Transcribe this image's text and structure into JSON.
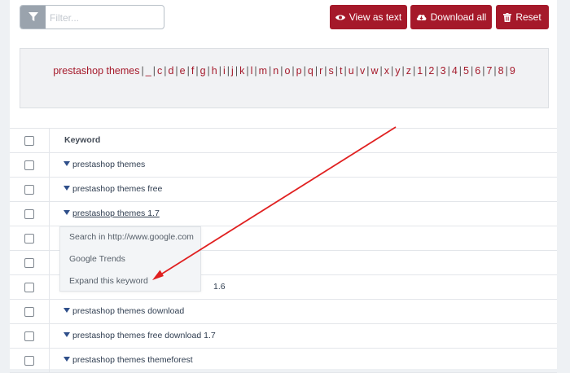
{
  "filter": {
    "placeholder": "Filter...",
    "icon": "filter-icon"
  },
  "buttons": {
    "view_as_text": "View as text",
    "download_all": "Download all",
    "reset": "Reset"
  },
  "colors": {
    "accent": "#a5192a",
    "link": "#2f4f8a",
    "text": "#2f3d50"
  },
  "alphabet": {
    "items": [
      "prestashop themes",
      "_",
      "c",
      "d",
      "e",
      "f",
      "g",
      "h",
      "i",
      "j",
      "k",
      "l",
      "m",
      "n",
      "o",
      "p",
      "q",
      "r",
      "s",
      "t",
      "u",
      "v",
      "w",
      "x",
      "y",
      "z",
      "1",
      "2",
      "3",
      "4",
      "5",
      "6",
      "7",
      "8",
      "9"
    ],
    "separator": "|"
  },
  "table": {
    "header": "Keyword",
    "rows": [
      "prestashop themes",
      "prestashop themes free",
      "prestashop themes 1.7",
      "",
      "",
      "1.6",
      "prestashop themes download",
      "prestashop themes free download 1.7",
      "prestashop themes themeforest"
    ]
  },
  "context_menu": {
    "items": [
      "Search in http://www.google.com",
      "Google Trends",
      "Expand this keyword"
    ]
  }
}
